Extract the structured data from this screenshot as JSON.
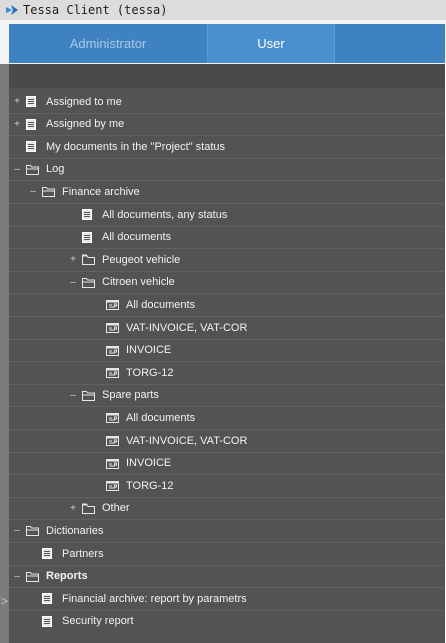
{
  "window": {
    "title": "Tessa Client (tessa)"
  },
  "tabs": [
    {
      "label": "Administrator"
    },
    {
      "label": "User"
    },
    {
      "label": ""
    }
  ],
  "tree": [
    {
      "label": "Assigned to me",
      "expander": "+",
      "icon": "doc",
      "level": 0
    },
    {
      "label": "Assigned by me",
      "expander": "+",
      "icon": "doc",
      "level": 0
    },
    {
      "label": "My documents in the \"Project\" status",
      "expander": "",
      "icon": "doc",
      "level": 0
    },
    {
      "label": "Log",
      "expander": "–",
      "icon": "folder-open",
      "level": 0
    },
    {
      "label": "Finance archive",
      "expander": "–",
      "icon": "folder-open",
      "level": 1
    },
    {
      "label": "All documents, any status",
      "expander": "",
      "icon": "doc",
      "level": 2
    },
    {
      "label": "All documents",
      "expander": "",
      "icon": "doc",
      "level": 2
    },
    {
      "label": "Peugeot vehicle",
      "expander": "+",
      "icon": "folder",
      "level": 2
    },
    {
      "label": "Citroen vehicle",
      "expander": "–",
      "icon": "folder-open",
      "level": 2
    },
    {
      "label": "All documents",
      "expander": "",
      "icon": "view",
      "level": 3
    },
    {
      "label": "VAT-INVOICE, VAT-COR",
      "expander": "",
      "icon": "view",
      "level": 3
    },
    {
      "label": "INVOICE",
      "expander": "",
      "icon": "view",
      "level": 3
    },
    {
      "label": "TORG-12",
      "expander": "",
      "icon": "view",
      "level": 3
    },
    {
      "label": "Spare parts",
      "expander": "–",
      "icon": "folder-open",
      "level": 2
    },
    {
      "label": "All documents",
      "expander": "",
      "icon": "view",
      "level": 3
    },
    {
      "label": "VAT-INVOICE, VAT-COR",
      "expander": "",
      "icon": "view",
      "level": 3
    },
    {
      "label": "INVOICE",
      "expander": "",
      "icon": "view",
      "level": 3
    },
    {
      "label": "TORG-12",
      "expander": "",
      "icon": "view",
      "level": 3
    },
    {
      "label": "Other",
      "expander": "+",
      "icon": "folder",
      "level": 2
    },
    {
      "label": "Dictionaries",
      "expander": "–",
      "icon": "folder-open",
      "level": 0
    },
    {
      "label": "Partners",
      "expander": "",
      "icon": "doc",
      "level": 1
    },
    {
      "label": "Reports",
      "expander": "–",
      "icon": "folder-open",
      "level": 0,
      "bold": true
    },
    {
      "label": "Financial archive: report by parametrs",
      "expander": "",
      "icon": "doc",
      "level": 1
    },
    {
      "label": "Security report",
      "expander": "",
      "icon": "doc",
      "level": 1
    }
  ],
  "rail": {
    "chevron": ">"
  }
}
